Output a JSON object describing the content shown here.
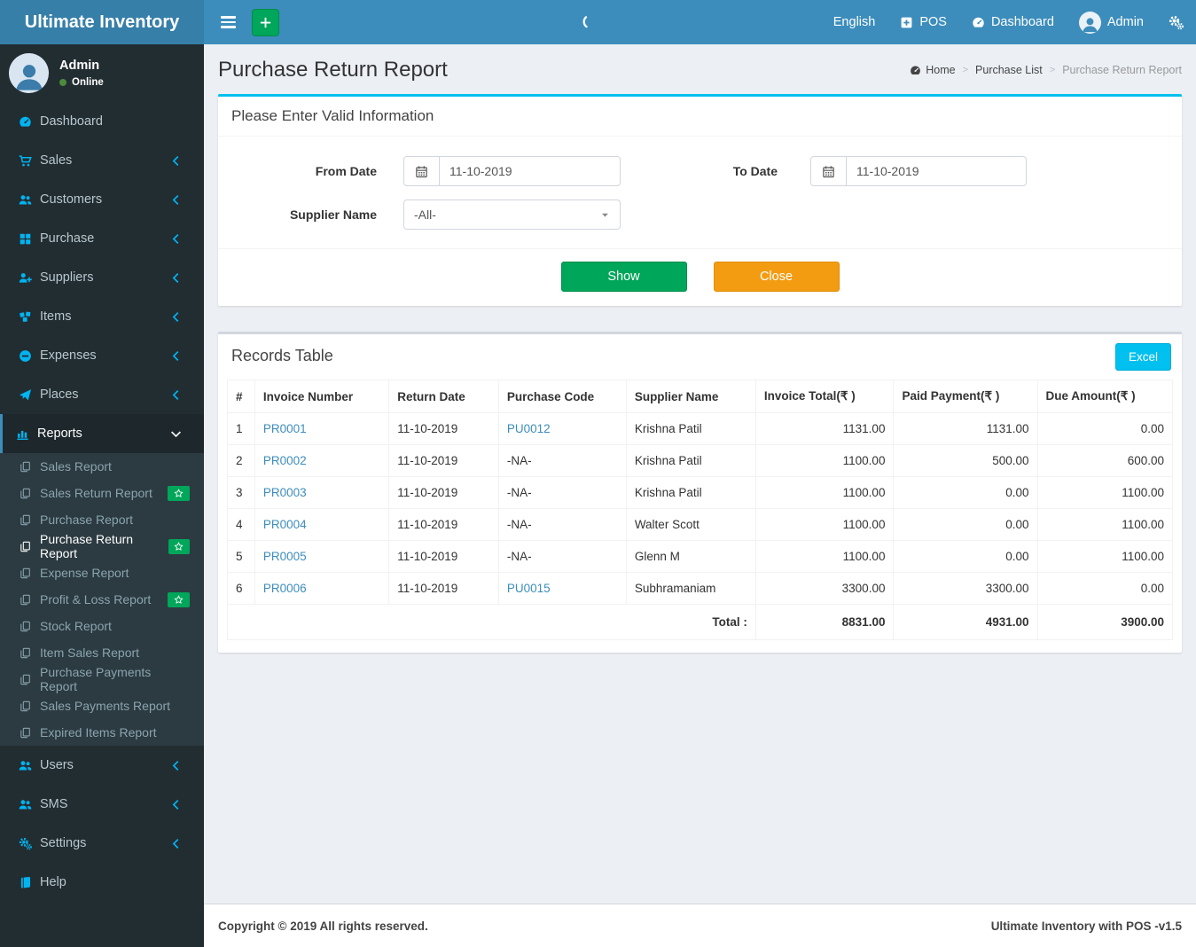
{
  "colors": {
    "navbar": "#3c8dbc",
    "logo_bg": "#367fa9",
    "sidebar": "#222d32",
    "accent": "#00c0ef",
    "success": "#00a65a",
    "warning": "#f39c12",
    "link": "#3c8dbc",
    "icon_blue": "#00b4f1"
  },
  "topbar": {
    "logo": "Ultimate Inventory",
    "menu": [
      {
        "label": "English",
        "icon": null
      },
      {
        "label": "POS",
        "icon": "plus-square-icon"
      },
      {
        "label": "Dashboard",
        "icon": "dashboard-icon"
      },
      {
        "label": "Admin",
        "icon": "avatar-icon"
      }
    ]
  },
  "user_panel": {
    "name": "Admin",
    "status": "Online"
  },
  "sidebar": {
    "items": [
      {
        "label": "Dashboard",
        "icon": "dashboard-icon",
        "chevron": false
      },
      {
        "label": "Sales",
        "icon": "cart-icon",
        "chevron": true
      },
      {
        "label": "Customers",
        "icon": "users-icon",
        "chevron": true
      },
      {
        "label": "Purchase",
        "icon": "grid-icon",
        "chevron": true
      },
      {
        "label": "Suppliers",
        "icon": "user-plus-icon",
        "chevron": true
      },
      {
        "label": "Items",
        "icon": "cubes-icon",
        "chevron": true
      },
      {
        "label": "Expenses",
        "icon": "minus-circle-icon",
        "chevron": true
      },
      {
        "label": "Places",
        "icon": "paper-plane-icon",
        "chevron": true
      },
      {
        "label": "Reports",
        "icon": "bar-chart-icon",
        "chevron": "down",
        "active": true,
        "submenu": [
          {
            "label": "Sales Report"
          },
          {
            "label": "Sales Return Report",
            "badge": true
          },
          {
            "label": "Purchase Report"
          },
          {
            "label": "Purchase Return Report",
            "active": true,
            "badge": true
          },
          {
            "label": "Expense Report"
          },
          {
            "label": "Profit & Loss Report",
            "badge": true
          },
          {
            "label": "Stock Report"
          },
          {
            "label": "Item Sales Report"
          },
          {
            "label": "Purchase Payments Report"
          },
          {
            "label": "Sales Payments Report"
          },
          {
            "label": "Expired Items Report"
          }
        ]
      },
      {
        "label": "Users",
        "icon": "users-icon",
        "chevron": true
      },
      {
        "label": "SMS",
        "icon": "users-icon",
        "chevron": true
      },
      {
        "label": "Settings",
        "icon": "cogs-icon",
        "chevron": true
      },
      {
        "label": "Help",
        "icon": "book-icon",
        "chevron": false
      }
    ]
  },
  "page": {
    "title": "Purchase Return Report",
    "breadcrumb": [
      {
        "label": "Home",
        "icon": "dashboard-icon"
      },
      {
        "label": "Purchase List"
      },
      {
        "label": "Purchase Return Report"
      }
    ]
  },
  "filter": {
    "title": "Please Enter Valid Information",
    "from_label": "From Date",
    "from_value": "11-10-2019",
    "to_label": "To Date",
    "to_value": "11-10-2019",
    "supplier_label": "Supplier Name",
    "supplier_value": "-All-",
    "show": "Show",
    "close": "Close"
  },
  "records": {
    "title": "Records Table",
    "excel": "Excel",
    "columns": [
      "#",
      "Invoice Number",
      "Return Date",
      "Purchase Code",
      "Supplier Name",
      "Invoice Total(₹ )",
      "Paid Payment(₹ )",
      "Due Amount(₹ )"
    ],
    "rows": [
      [
        "1",
        "PR0001",
        "11-10-2019",
        "PU0012",
        "Krishna Patil",
        "1131.00",
        "1131.00",
        "0.00"
      ],
      [
        "2",
        "PR0002",
        "11-10-2019",
        "-NA-",
        "Krishna Patil",
        "1100.00",
        "500.00",
        "600.00"
      ],
      [
        "3",
        "PR0003",
        "11-10-2019",
        "-NA-",
        "Krishna Patil",
        "1100.00",
        "0.00",
        "1100.00"
      ],
      [
        "4",
        "PR0004",
        "11-10-2019",
        "-NA-",
        "Walter Scott",
        "1100.00",
        "0.00",
        "1100.00"
      ],
      [
        "5",
        "PR0005",
        "11-10-2019",
        "-NA-",
        "Glenn M",
        "1100.00",
        "0.00",
        "1100.00"
      ],
      [
        "6",
        "PR0006",
        "11-10-2019",
        "PU0015",
        "Subhramaniam",
        "3300.00",
        "3300.00",
        "0.00"
      ]
    ],
    "total_label": "Total :",
    "totals": [
      "8831.00",
      "4931.00",
      "3900.00"
    ]
  },
  "footer": {
    "left": "Copyright © 2019 All rights reserved.",
    "right": "Ultimate Inventory with POS -v1.5"
  }
}
